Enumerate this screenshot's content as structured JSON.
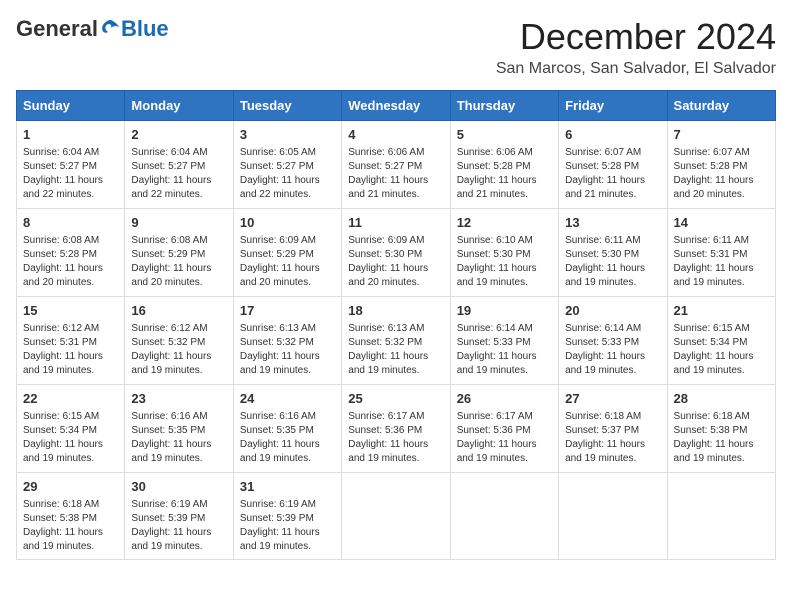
{
  "logo": {
    "general": "General",
    "blue": "Blue"
  },
  "title": "December 2024",
  "location": "San Marcos, San Salvador, El Salvador",
  "days_of_week": [
    "Sunday",
    "Monday",
    "Tuesday",
    "Wednesday",
    "Thursday",
    "Friday",
    "Saturday"
  ],
  "weeks": [
    [
      {
        "day": "1",
        "sunrise": "6:04 AM",
        "sunset": "5:27 PM",
        "daylight": "11 hours and 22 minutes."
      },
      {
        "day": "2",
        "sunrise": "6:04 AM",
        "sunset": "5:27 PM",
        "daylight": "11 hours and 22 minutes."
      },
      {
        "day": "3",
        "sunrise": "6:05 AM",
        "sunset": "5:27 PM",
        "daylight": "11 hours and 22 minutes."
      },
      {
        "day": "4",
        "sunrise": "6:06 AM",
        "sunset": "5:27 PM",
        "daylight": "11 hours and 21 minutes."
      },
      {
        "day": "5",
        "sunrise": "6:06 AM",
        "sunset": "5:28 PM",
        "daylight": "11 hours and 21 minutes."
      },
      {
        "day": "6",
        "sunrise": "6:07 AM",
        "sunset": "5:28 PM",
        "daylight": "11 hours and 21 minutes."
      },
      {
        "day": "7",
        "sunrise": "6:07 AM",
        "sunset": "5:28 PM",
        "daylight": "11 hours and 20 minutes."
      }
    ],
    [
      {
        "day": "8",
        "sunrise": "6:08 AM",
        "sunset": "5:28 PM",
        "daylight": "11 hours and 20 minutes."
      },
      {
        "day": "9",
        "sunrise": "6:08 AM",
        "sunset": "5:29 PM",
        "daylight": "11 hours and 20 minutes."
      },
      {
        "day": "10",
        "sunrise": "6:09 AM",
        "sunset": "5:29 PM",
        "daylight": "11 hours and 20 minutes."
      },
      {
        "day": "11",
        "sunrise": "6:09 AM",
        "sunset": "5:30 PM",
        "daylight": "11 hours and 20 minutes."
      },
      {
        "day": "12",
        "sunrise": "6:10 AM",
        "sunset": "5:30 PM",
        "daylight": "11 hours and 19 minutes."
      },
      {
        "day": "13",
        "sunrise": "6:11 AM",
        "sunset": "5:30 PM",
        "daylight": "11 hours and 19 minutes."
      },
      {
        "day": "14",
        "sunrise": "6:11 AM",
        "sunset": "5:31 PM",
        "daylight": "11 hours and 19 minutes."
      }
    ],
    [
      {
        "day": "15",
        "sunrise": "6:12 AM",
        "sunset": "5:31 PM",
        "daylight": "11 hours and 19 minutes."
      },
      {
        "day": "16",
        "sunrise": "6:12 AM",
        "sunset": "5:32 PM",
        "daylight": "11 hours and 19 minutes."
      },
      {
        "day": "17",
        "sunrise": "6:13 AM",
        "sunset": "5:32 PM",
        "daylight": "11 hours and 19 minutes."
      },
      {
        "day": "18",
        "sunrise": "6:13 AM",
        "sunset": "5:32 PM",
        "daylight": "11 hours and 19 minutes."
      },
      {
        "day": "19",
        "sunrise": "6:14 AM",
        "sunset": "5:33 PM",
        "daylight": "11 hours and 19 minutes."
      },
      {
        "day": "20",
        "sunrise": "6:14 AM",
        "sunset": "5:33 PM",
        "daylight": "11 hours and 19 minutes."
      },
      {
        "day": "21",
        "sunrise": "6:15 AM",
        "sunset": "5:34 PM",
        "daylight": "11 hours and 19 minutes."
      }
    ],
    [
      {
        "day": "22",
        "sunrise": "6:15 AM",
        "sunset": "5:34 PM",
        "daylight": "11 hours and 19 minutes."
      },
      {
        "day": "23",
        "sunrise": "6:16 AM",
        "sunset": "5:35 PM",
        "daylight": "11 hours and 19 minutes."
      },
      {
        "day": "24",
        "sunrise": "6:16 AM",
        "sunset": "5:35 PM",
        "daylight": "11 hours and 19 minutes."
      },
      {
        "day": "25",
        "sunrise": "6:17 AM",
        "sunset": "5:36 PM",
        "daylight": "11 hours and 19 minutes."
      },
      {
        "day": "26",
        "sunrise": "6:17 AM",
        "sunset": "5:36 PM",
        "daylight": "11 hours and 19 minutes."
      },
      {
        "day": "27",
        "sunrise": "6:18 AM",
        "sunset": "5:37 PM",
        "daylight": "11 hours and 19 minutes."
      },
      {
        "day": "28",
        "sunrise": "6:18 AM",
        "sunset": "5:38 PM",
        "daylight": "11 hours and 19 minutes."
      }
    ],
    [
      {
        "day": "29",
        "sunrise": "6:18 AM",
        "sunset": "5:38 PM",
        "daylight": "11 hours and 19 minutes."
      },
      {
        "day": "30",
        "sunrise": "6:19 AM",
        "sunset": "5:39 PM",
        "daylight": "11 hours and 19 minutes."
      },
      {
        "day": "31",
        "sunrise": "6:19 AM",
        "sunset": "5:39 PM",
        "daylight": "11 hours and 19 minutes."
      },
      null,
      null,
      null,
      null
    ]
  ],
  "labels": {
    "sunrise_prefix": "Sunrise: ",
    "sunset_prefix": "Sunset: ",
    "daylight_prefix": "Daylight: "
  }
}
